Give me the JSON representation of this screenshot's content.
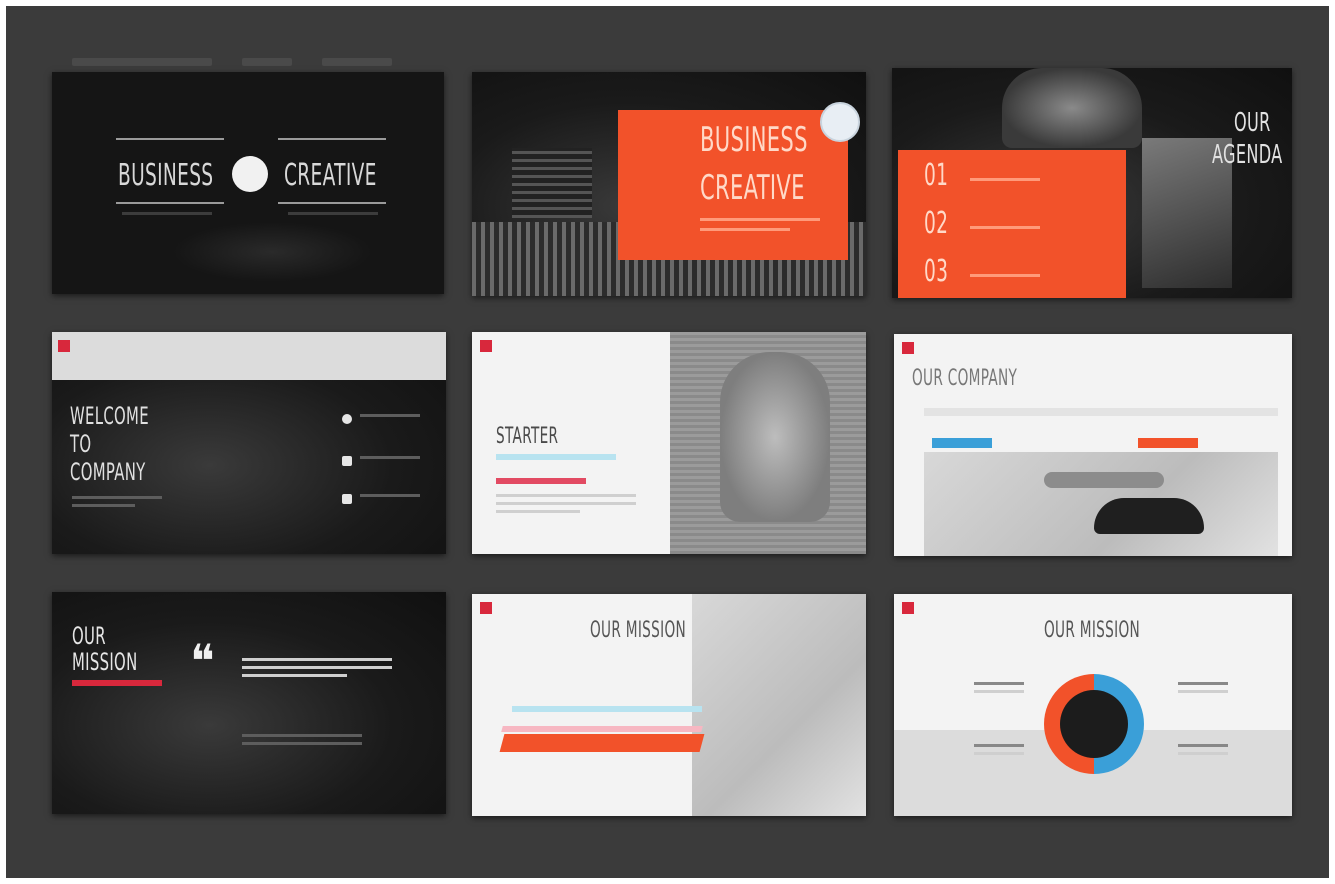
{
  "slides": {
    "s1": {
      "left_word": "BUSINESS",
      "right_word": "CREATIVE"
    },
    "s2": {
      "line1": "BUSINESS",
      "line2": "CREATIVE"
    },
    "s3": {
      "title_line1": "OUR",
      "title_line2": "AGENDA",
      "items": [
        "01",
        "02",
        "03"
      ]
    },
    "s4": {
      "line1": "WELCOME",
      "line2": "TO",
      "line3": "COMPANY"
    },
    "s5": {
      "title": "STARTER"
    },
    "s6": {
      "title": "OUR COMPANY"
    },
    "s7": {
      "line1": "OUR",
      "line2": "MISSION"
    },
    "s8": {
      "title": "OUR MISSION"
    },
    "s9": {
      "title": "OUR MISSION"
    }
  },
  "colors": {
    "accent_orange": "#f2522a",
    "accent_red": "#d8283c",
    "accent_blue": "#3a9fd8",
    "background": "#3b3b3b"
  }
}
